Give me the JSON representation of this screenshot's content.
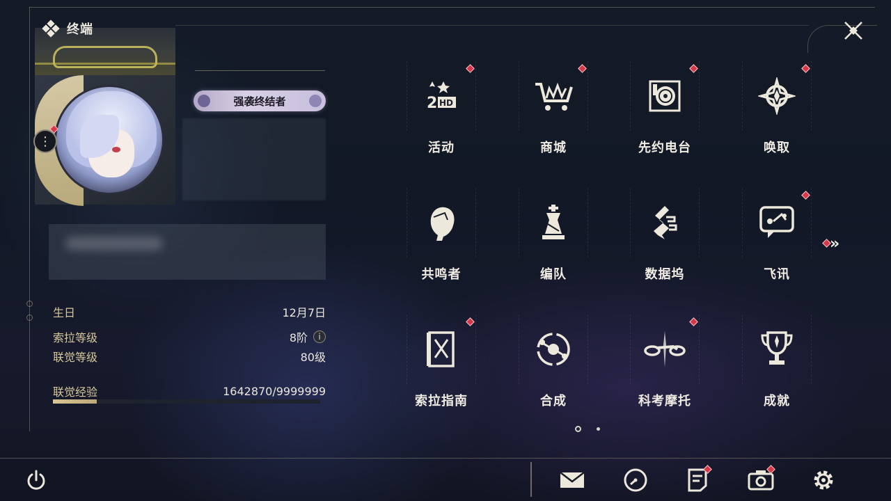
{
  "header": {
    "title": "终端",
    "logo_icon": "diamond-cluster-icon"
  },
  "close": {
    "icon": "close-x-icon"
  },
  "profile": {
    "title_badge": "强袭终结者",
    "stats": [
      {
        "key": "生日",
        "value": "12月7日"
      },
      {
        "key": "索拉等级",
        "value": "8阶"
      },
      {
        "key": "联觉等级",
        "value": "80级"
      },
      {
        "key": "联觉经验",
        "value": "1642870/9999999"
      }
    ],
    "exp_ratio": 0.164
  },
  "grid": [
    {
      "label": "活动",
      "icon": "events-2hd-icon",
      "badge": true
    },
    {
      "label": "商城",
      "icon": "shop-cart-icon",
      "badge": true
    },
    {
      "label": "先约电台",
      "icon": "radio-record-icon",
      "badge": true
    },
    {
      "label": "唤取",
      "icon": "compass-star-icon",
      "badge": true
    },
    {
      "label": "共鸣者",
      "icon": "character-head-icon",
      "badge": false
    },
    {
      "label": "编队",
      "icon": "chess-piece-icon",
      "badge": false
    },
    {
      "label": "数据坞",
      "icon": "data-dock-icon",
      "badge": false
    },
    {
      "label": "飞讯",
      "icon": "chat-bubble-icon",
      "badge": true
    },
    {
      "label": "索拉指南",
      "icon": "guide-book-icon",
      "badge": true
    },
    {
      "label": "合成",
      "icon": "synthesis-ring-icon",
      "badge": false
    },
    {
      "label": "科考摩托",
      "icon": "motorbike-icon",
      "badge": true
    },
    {
      "label": "成就",
      "icon": "trophy-icon",
      "badge": false
    }
  ],
  "pager": {
    "current": 1,
    "total": 2
  },
  "bottom": {
    "power_icon": "power-icon",
    "buttons": [
      {
        "icon": "mail-icon",
        "badge": false
      },
      {
        "icon": "clock-icon",
        "badge": false
      },
      {
        "icon": "notice-icon",
        "badge": true
      },
      {
        "icon": "camera-icon",
        "badge": true
      },
      {
        "icon": "settings-gear-icon",
        "badge": false
      }
    ]
  },
  "colors": {
    "accent": "#d6384a",
    "gold": "#d7c79b",
    "text": "#f0ece3"
  }
}
